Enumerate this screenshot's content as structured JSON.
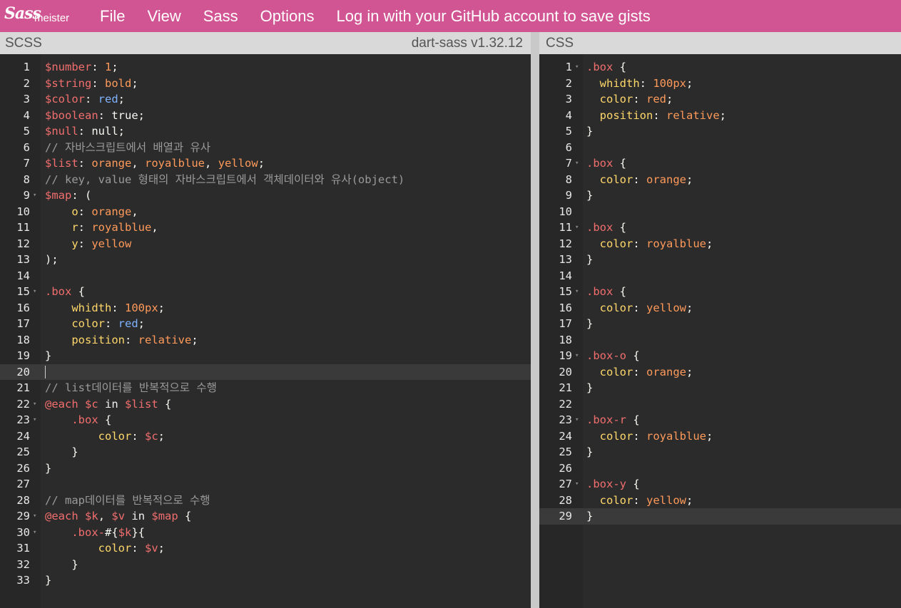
{
  "app": {
    "logo_script": "Sass",
    "logo_text": "meister",
    "menu": [
      "File",
      "View",
      "Sass",
      "Options",
      "Log in with your GitHub account to save gists"
    ]
  },
  "left_pane": {
    "title": "SCSS",
    "version": "dart-sass v1.32.12",
    "active_line": 20,
    "lines": [
      "$number: 1;",
      "$string: bold;",
      "$color: red;",
      "$boolean: true;",
      "$null: null;",
      "// 자바스크립트에서 배열과 유사",
      "$list: orange, royalblue, yellow;",
      "// key, value 형태의 자바스크립트에서 객체데이터와 유사(object)",
      "$map: (",
      "    o: orange,",
      "    r: royalblue,",
      "    y: yellow",
      ");",
      "",
      ".box {",
      "    whidth: 100px;",
      "    color: red;",
      "    position: relative;",
      "}",
      "",
      "// list데이터를 반복적으로 수행",
      "@each $c in $list {",
      "    .box {",
      "        color: $c;",
      "    }",
      "}",
      "",
      "// map데이터를 반복적으로 수행",
      "@each $k, $v in $map {",
      "    .box-#{$k}{",
      "        color: $v;",
      "    }",
      "}"
    ]
  },
  "right_pane": {
    "title": "CSS",
    "active_line": 29,
    "lines": [
      ".box {",
      "  whidth: 100px;",
      "  color: red;",
      "  position: relative;",
      "}",
      "",
      ".box {",
      "  color: orange;",
      "}",
      "",
      ".box {",
      "  color: royalblue;",
      "}",
      "",
      ".box {",
      "  color: yellow;",
      "}",
      "",
      ".box-o {",
      "  color: orange;",
      "}",
      "",
      ".box-r {",
      "  color: royalblue;",
      "}",
      "",
      ".box-y {",
      "  color: yellow;",
      "}"
    ]
  }
}
